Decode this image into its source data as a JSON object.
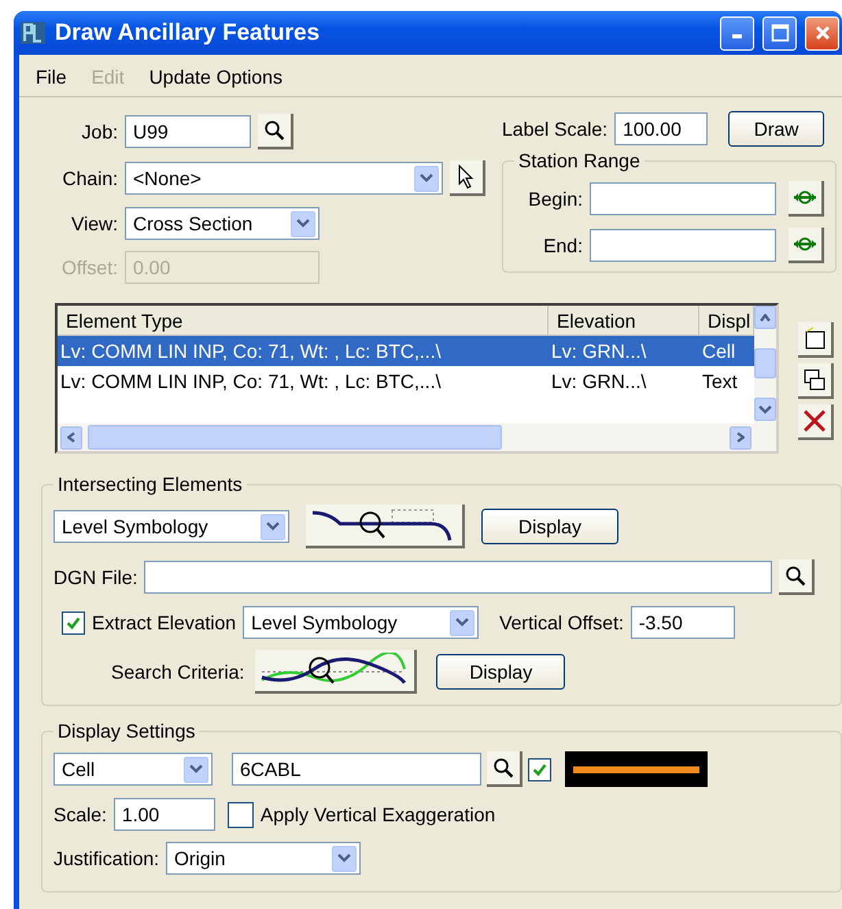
{
  "window": {
    "title": "Draw Ancillary Features"
  },
  "menu": [
    {
      "label": "File",
      "disabled": false
    },
    {
      "label": "Edit",
      "disabled": true
    },
    {
      "label": "Update Options",
      "disabled": false
    }
  ],
  "job": {
    "label": "Job:",
    "value": "U99"
  },
  "label_scale": {
    "label": "Label Scale:",
    "value": "100.00"
  },
  "draw_button": "Draw",
  "chain": {
    "label": "Chain:",
    "value": "<None>"
  },
  "view": {
    "label": "View:",
    "value": "Cross Section"
  },
  "offset": {
    "label": "Offset:",
    "value": "0.00",
    "disabled": true
  },
  "station_range": {
    "title": "Station Range",
    "begin_label": "Begin:",
    "end_label": "End:"
  },
  "table": {
    "columns": [
      "Element Type",
      "Elevation",
      "Displ"
    ],
    "rows": [
      {
        "cells": [
          "Lv: COMM LIN INP, Co: 71, Wt: , Lc: BTC,...\\",
          "Lv: GRN...\\",
          "Cell"
        ],
        "selected": true
      },
      {
        "cells": [
          "Lv: COMM LIN INP, Co: 71, Wt: , Lc: BTC,...\\",
          "Lv: GRN...\\",
          "Text"
        ],
        "selected": false
      }
    ]
  },
  "intersecting": {
    "title": "Intersecting Elements",
    "mode": "Level Symbology",
    "display_button": "Display",
    "dgn_label": "DGN File:",
    "extract": {
      "label": "Extract Elevation",
      "checked": true
    },
    "extract_mode": "Level Symbology",
    "vertical_offset": {
      "label": "Vertical Offset:",
      "value": "-3.50"
    },
    "search_label": "Search Criteria:",
    "search_display": "Display"
  },
  "display_settings": {
    "title": "Display Settings",
    "type": "Cell",
    "cell_name": "6CABL",
    "show_checked": true,
    "scale": {
      "label": "Scale:",
      "value": "1.00"
    },
    "apply_vertical": {
      "label": "Apply Vertical Exaggeration",
      "checked": false
    },
    "justification": {
      "label": "Justification:",
      "value": "Origin"
    }
  }
}
